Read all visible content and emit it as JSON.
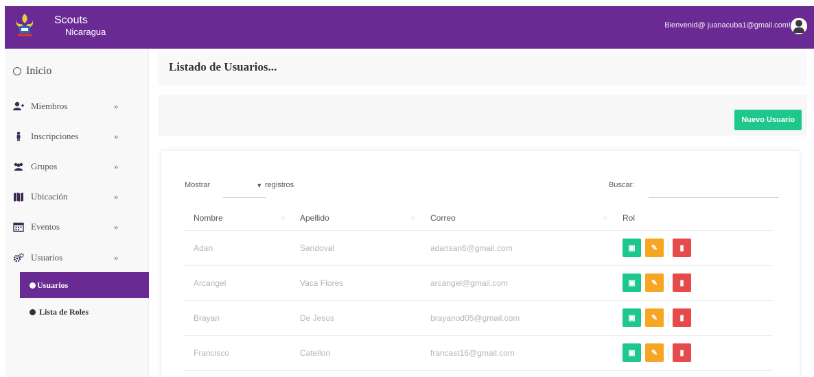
{
  "header": {
    "brand_line1": "Scouts",
    "brand_line2": "Nicaragua",
    "welcome": "Bienvenid@ juanacuba1@gmail.com!",
    "accent": "#6a2a94"
  },
  "sidebar": {
    "inicio": "Inicio",
    "items": [
      {
        "label": "Miembros",
        "icon": "user-plus-icon"
      },
      {
        "label": "Inscripciones",
        "icon": "person-icon"
      },
      {
        "label": "Grupos",
        "icon": "users-icon"
      },
      {
        "label": "Ubicación",
        "icon": "map-icon"
      },
      {
        "label": "Eventos",
        "icon": "calendar-icon"
      },
      {
        "label": "Usuarios",
        "icon": "cogs-icon"
      }
    ],
    "chevron": "»",
    "sub_active": "Usuarios",
    "sub_item": "Lista de Roles"
  },
  "main": {
    "title": "Listado de Usuarios...",
    "new_button": "Nuevo Usuario",
    "show_label": "Mostrar",
    "registros": "registros",
    "search_label": "Buscar:",
    "columns": [
      "Nombre",
      "Apellido",
      "Correo",
      "Rol"
    ],
    "rows": [
      {
        "nombre": "Adan",
        "apellido": "Sandoval",
        "correo": "adansan6@gmail.com"
      },
      {
        "nombre": "Arcangel",
        "apellido": "Vaca Flores",
        "correo": "arcangel@gmail.com"
      },
      {
        "nombre": "Brayan",
        "apellido": "De Jesus",
        "correo": "brayanod05@gmail.com"
      },
      {
        "nombre": "Francisco",
        "apellido": "Catellon",
        "correo": "francast16@gmail.com"
      }
    ],
    "colors": {
      "green": "#1ec78c",
      "orange": "#f6a623",
      "red": "#e64a4a"
    }
  }
}
